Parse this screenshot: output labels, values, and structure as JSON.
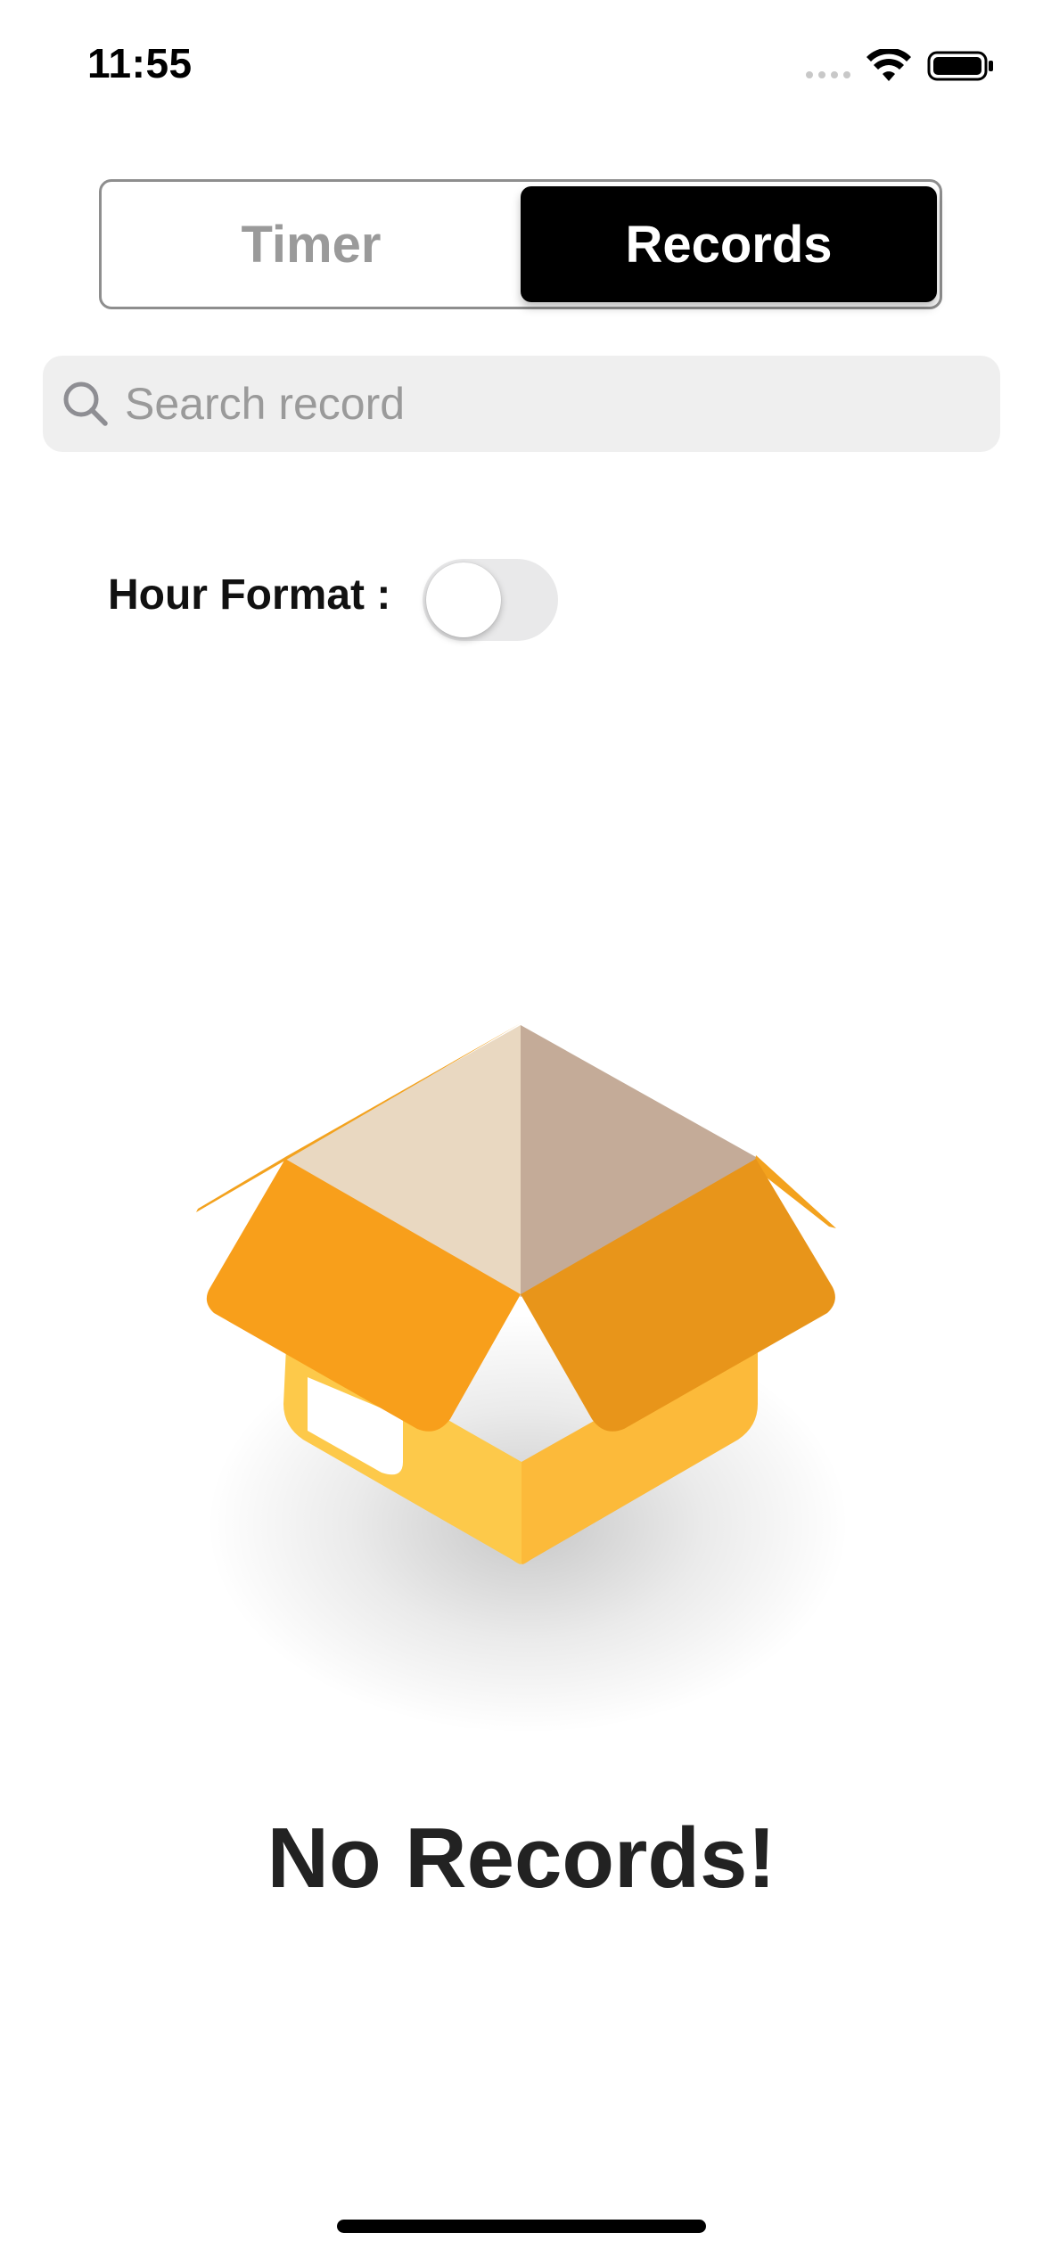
{
  "status_bar": {
    "time": "11:55"
  },
  "segmented_control": {
    "tabs": [
      {
        "label": "Timer",
        "selected": false
      },
      {
        "label": "Records",
        "selected": true
      }
    ]
  },
  "search": {
    "placeholder": "Search record",
    "value": ""
  },
  "settings": {
    "hour_format_label": "Hour Format :",
    "hour_format_enabled": false
  },
  "empty_state": {
    "illustration": "open-box-icon",
    "message": "No Records!"
  },
  "colors": {
    "accent_selected_bg": "#000000",
    "box_orange": "#f89f1b",
    "box_dark_orange": "#e8951a",
    "box_yellow": "#fdc94a",
    "box_inner_light": "#e9d8c1",
    "box_inner_dark": "#c4ab98"
  }
}
